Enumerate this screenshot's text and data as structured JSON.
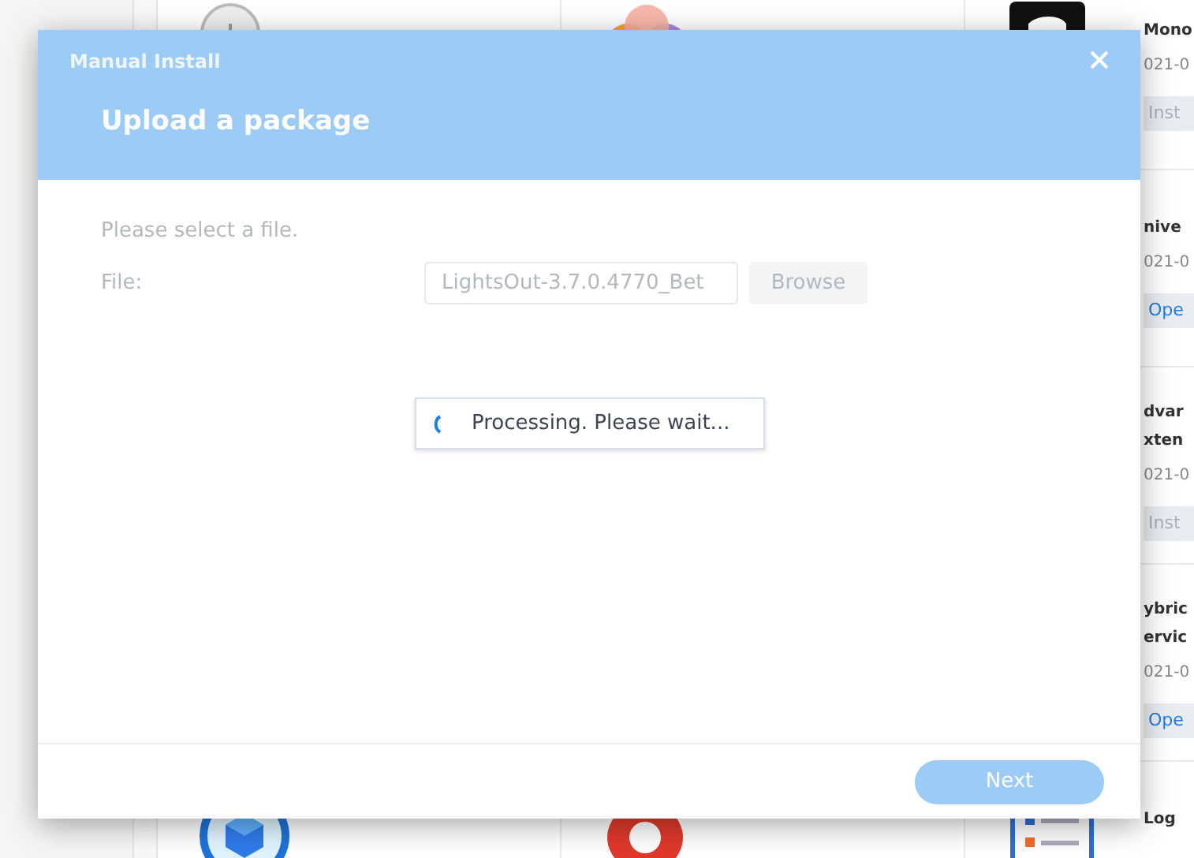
{
  "background": {
    "packages": [
      {
        "title_lines": [
          "Mono"
        ],
        "date": "021-0",
        "action": {
          "label": "Inst",
          "kind": "install"
        }
      },
      {
        "title_lines": [
          "nive"
        ],
        "date": "021-0",
        "action": {
          "label": "Ope",
          "kind": "open"
        }
      },
      {
        "title_lines": [
          "dvar",
          "xten"
        ],
        "date": "021-0",
        "action": {
          "label": "Inst",
          "kind": "install"
        }
      },
      {
        "title_lines": [
          "ybric",
          "ervic"
        ],
        "date": "021-0",
        "action": {
          "label": "Ope",
          "kind": "open"
        }
      },
      {
        "title_lines": [
          "Log"
        ]
      }
    ]
  },
  "dialog": {
    "title": "Manual Install",
    "heading": "Upload a package",
    "prompt": "Please select a file.",
    "file_label": "File:",
    "file_field": {
      "value": "LightsOut-3.7.0.4770_Bet",
      "disabled": true
    },
    "browse_button": {
      "label": "Browse",
      "disabled": true
    },
    "progress": {
      "text": "Processing. Please wait..."
    },
    "next_button": {
      "label": "Next",
      "disabled": true
    }
  }
}
